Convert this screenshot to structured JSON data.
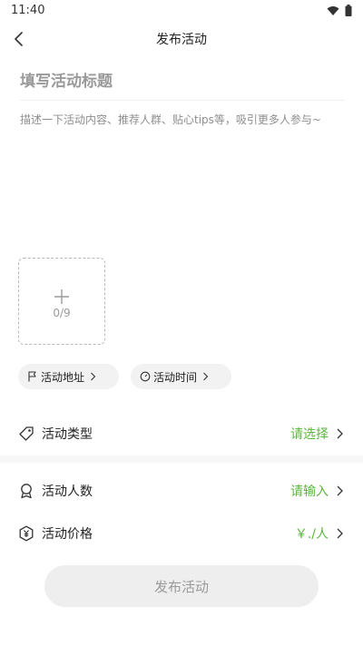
{
  "status_bar": {
    "time": "11:40",
    "icons": [
      "wifi-icon",
      "battery-icon"
    ]
  },
  "header": {
    "title": "发布活动",
    "back_icon": "chevron-left-icon"
  },
  "form": {
    "title_placeholder": "填写活动标题",
    "desc_placeholder": "描述一下活动内容、推荐人群、贴心tips等，吸引更多人参与~",
    "upload_count": "0/9"
  },
  "chips": {
    "address_label": "活动地址",
    "time_label": "活动时间"
  },
  "rows": {
    "type": {
      "label": "活动类型",
      "value": "请选择"
    },
    "people": {
      "label": "活动人数",
      "value": "请输入"
    },
    "price": {
      "label": "活动价格",
      "value": "￥./人"
    }
  },
  "publish_button_label": "发布活动",
  "colors": {
    "accent_green": "#5db53f",
    "placeholder_gray": "#9a9a9a",
    "button_bg": "#eeeeee"
  }
}
